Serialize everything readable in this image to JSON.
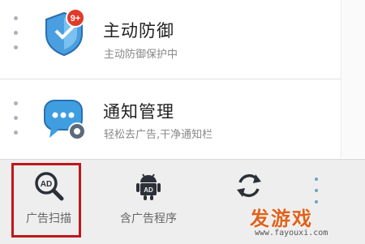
{
  "list": {
    "items": [
      {
        "title": "主动防御",
        "subtitle": "主动防御保护中",
        "icon": "shield-icon",
        "badge": "9+"
      },
      {
        "title": "通知管理",
        "subtitle": "轻松去广告,干净通知栏",
        "icon": "chat-bubble-gear-icon"
      }
    ]
  },
  "toolbar": {
    "items": [
      {
        "label": "广告扫描",
        "icon": "ad-scan-icon",
        "selected": true
      },
      {
        "label": "含广告程序",
        "icon": "android-ad-icon"
      },
      {
        "label": "",
        "icon": "refresh-icon"
      }
    ]
  },
  "watermark": {
    "main": "发游戏",
    "url": "www.fayouxi.com"
  },
  "colors": {
    "highlight": "#c0171b",
    "watermark": "#e0621d",
    "icon_dark": "#2b3038"
  }
}
